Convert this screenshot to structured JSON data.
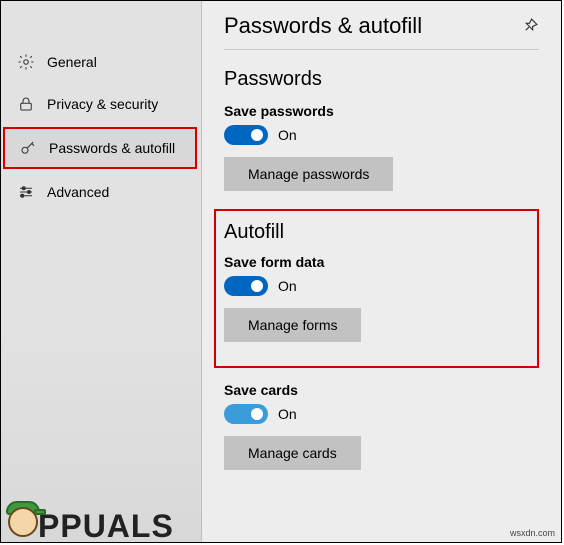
{
  "sidebar": {
    "items": [
      {
        "label": "General"
      },
      {
        "label": "Privacy & security"
      },
      {
        "label": "Passwords & autofill"
      },
      {
        "label": "Advanced"
      }
    ]
  },
  "header": {
    "title": "Passwords & autofill"
  },
  "passwords": {
    "heading": "Passwords",
    "save_label": "Save passwords",
    "save_state": "On",
    "manage_label": "Manage passwords"
  },
  "autofill": {
    "heading": "Autofill",
    "form_label": "Save form data",
    "form_state": "On",
    "manage_forms_label": "Manage forms",
    "cards_label": "Save cards",
    "cards_state": "On",
    "manage_cards_label": "Manage cards"
  },
  "watermark": "wsxdn.com",
  "brand": "PPUALS"
}
